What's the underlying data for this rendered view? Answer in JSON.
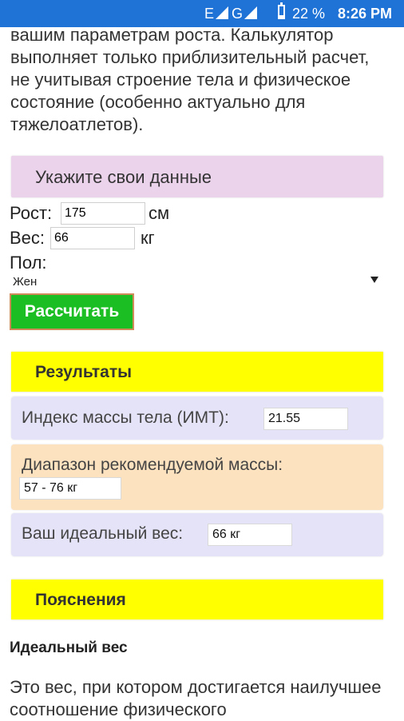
{
  "status_bar": {
    "network_e": "E",
    "network_g": "G",
    "battery": "22 %",
    "battery_level": 0.22,
    "time": "8:26 PM",
    "background": "#1f72d6"
  },
  "intro_text": "вашим параметрам роста. Калькулятор выполняет только приблизительный расчет, не учитывая строение тела и физическое состояние (особенно актуально для тяжелоатлетов).",
  "form": {
    "header": "Укажите свои данные",
    "height_label": "Рост:",
    "height_value": "175",
    "height_unit": "см",
    "weight_label": "Вес:",
    "weight_value": "66",
    "weight_unit": "кг",
    "gender_label": "Пол:",
    "gender_selected": "Жен",
    "calculate_button": "Рассчитать"
  },
  "results": {
    "header": "Результаты",
    "bmi_label": "Индекс массы тела (ИМТ):",
    "bmi_value": "21.55",
    "range_label": "Диапазон рекомендуемой массы:",
    "range_value": "57 - 76 кг",
    "ideal_label": "Ваш идеальный вес:",
    "ideal_value": "66 кг"
  },
  "explanations": {
    "header": "Пояснения",
    "section_title": "Идеальный вес",
    "section_text": "Это вес, при котором достигается наилучшее соотношение физического"
  },
  "colors": {
    "form_header_bg": "#ecd3ec",
    "button_green": "#1bbf23",
    "results_header_bg": "#ffff00",
    "card_lavender": "#e5e3f7",
    "card_peach": "#fde2bf"
  }
}
